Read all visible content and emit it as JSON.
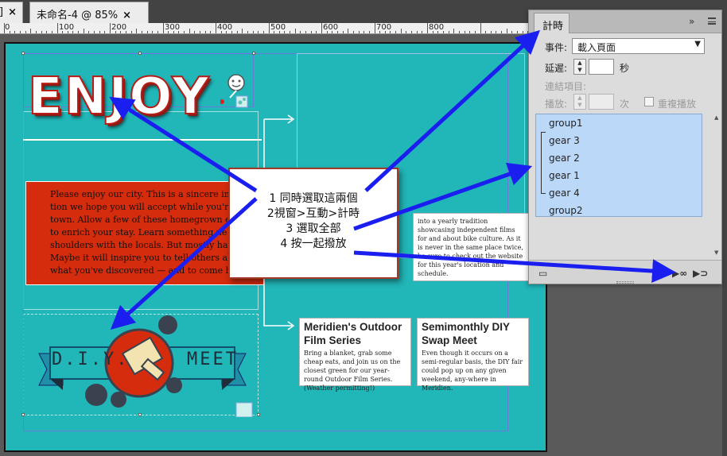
{
  "tabs": [
    {
      "label": "]",
      "close": "×"
    },
    {
      "label": "未命名-4 @ 85%",
      "close": "×"
    }
  ],
  "ruler": {
    "labels": [
      "0",
      "100",
      "200",
      "300",
      "400",
      "500",
      "600",
      "700",
      "800"
    ]
  },
  "page": {
    "enjoy_text": "ENJOY",
    "intro_lines": [
      "Please enjoy our city. This is a sincere invit",
      "tion we hope you will accept while you're i",
      "town. Allow a few of these homegrown eve",
      "to enrich your stay. Learn something ne",
      "shoulders with the locals. But mostly have",
      "Maybe it will inspire you to tell others abou",
      "what you've discovered — and to come bac"
    ],
    "banner_left": "D.I.Y.",
    "banner_right": "MEET",
    "film_card": {
      "title": "Meridien's Outdoor Film Series",
      "body": "Bring a blanket, grab some cheap eats, and join us on the closest green for our year-round Outdoor Film Series. (Weather permitting!)"
    },
    "swap_card": {
      "title": "Semimonthly DIY Swap Meet",
      "body": "Even though it occurs on a semi-regular basis, the DIY fair could pop up on any given weekend, any-where in Meridien."
    },
    "bike_card": {
      "body": "into a yearly tradition showcasing independent films for and about bike culture. As it is never in the same place twice, be sure to check out the website for this year's location and schedule."
    }
  },
  "instructions": [
    "1 同時選取這兩個",
    "2視窗>互動>計時",
    "3 選取全部",
    "4 按一起撥放"
  ],
  "timing_panel": {
    "tab_label": "計時",
    "collapse_glyph": "»",
    "event_label": "事件:",
    "event_value": "載入頁面",
    "delay_label": "延遲:",
    "delay_unit": "秒",
    "linked_label": "連結項目:",
    "play_label": "播放:",
    "play_unit": "次",
    "repeat_label": "重複播放",
    "items": [
      "group1",
      "gear 3",
      "gear 2",
      "gear 1",
      "gear 4",
      "group2"
    ],
    "preview_icon": "preview-spread-icon",
    "play_together_icon": "play-together-icon",
    "play_separately_icon": "play-separately-icon"
  },
  "colors": {
    "page_bg": "#21b6b8",
    "red_box": "#d42c0c",
    "arrow": "#1a1ff0",
    "list_highlight": "#bcd8f8"
  }
}
